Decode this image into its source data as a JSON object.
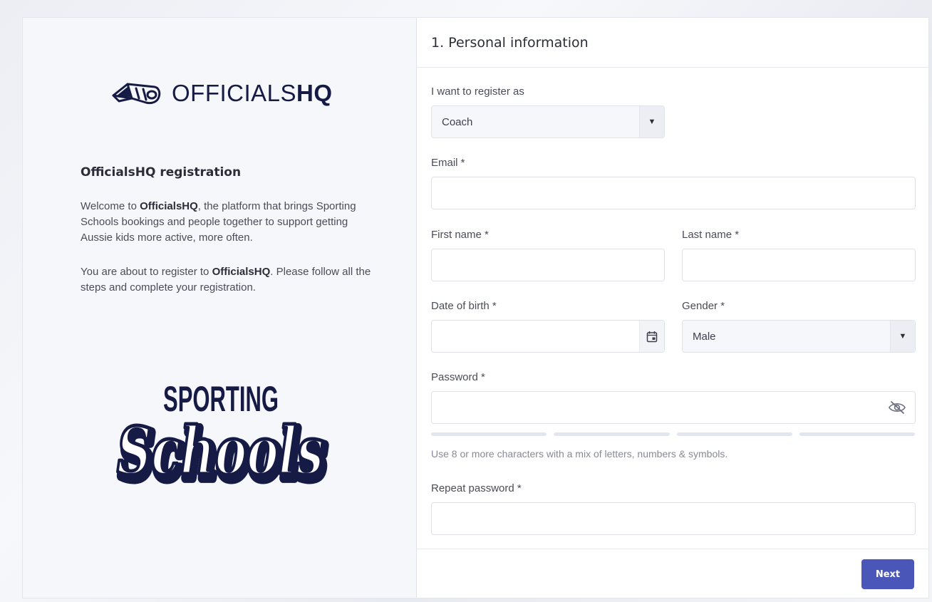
{
  "left": {
    "brand_light": "OFFICIALS",
    "brand_bold": "HQ",
    "registration_title": "OfficialsHQ registration",
    "intro1_pre": "Welcome to ",
    "intro1_bold": "OfficialsHQ",
    "intro1_post": ", the platform that brings Sporting Schools bookings and people together to support getting Aussie kids more active, more often.",
    "intro2_pre": "You are about to register to ",
    "intro2_bold": "OfficialsHQ",
    "intro2_post": ". Please follow all the steps and complete your registration.",
    "sporting_logo_line1": "SPORTING",
    "sporting_logo_line2": "Schools"
  },
  "form": {
    "section_title": "1. Personal information",
    "register_as_label": "I want to register as",
    "register_as_value": "Coach",
    "email_label": "Email *",
    "first_name_label": "First name *",
    "last_name_label": "Last name *",
    "dob_label": "Date of birth *",
    "gender_label": "Gender *",
    "gender_value": "Male",
    "password_label": "Password *",
    "password_hint": "Use 8 or more characters with a mix of letters, numbers & symbols.",
    "repeat_password_label": "Repeat password *",
    "next_label": "Next"
  },
  "colors": {
    "primary": "#4a56b8",
    "brand_navy": "#161b46"
  }
}
